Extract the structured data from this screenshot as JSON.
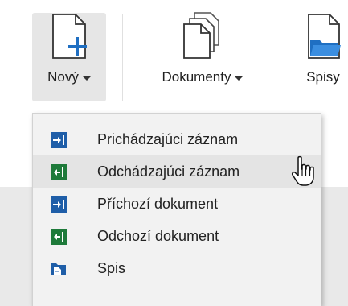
{
  "toolbar": {
    "new_label": "Nový",
    "documents_label": "Dokumenty",
    "files_label": "Spisy"
  },
  "menu": {
    "items": [
      {
        "label": "Prichádzajúci záznam",
        "icon": "incoming-arrow-icon",
        "color": "#1f5ea8"
      },
      {
        "label": "Odchádzajúci záznam",
        "icon": "outgoing-arrow-icon",
        "color": "#1e7a3a"
      },
      {
        "label": "Příchozí dokument",
        "icon": "incoming-arrow-icon",
        "color": "#1f5ea8"
      },
      {
        "label": "Odchozí dokument",
        "icon": "outgoing-arrow-icon",
        "color": "#1e7a3a"
      },
      {
        "label": "Spis",
        "icon": "folder-file-icon",
        "color": "#1f5ea8"
      }
    ],
    "hovered_item": "Odchádzajúci záznam"
  },
  "colors": {
    "accent_blue": "#1f6fc2",
    "incoming": "#1f5ea8",
    "outgoing": "#1e7a3a",
    "menu_bg": "#f2f2f2",
    "active_button_bg": "#e6e6e6"
  }
}
